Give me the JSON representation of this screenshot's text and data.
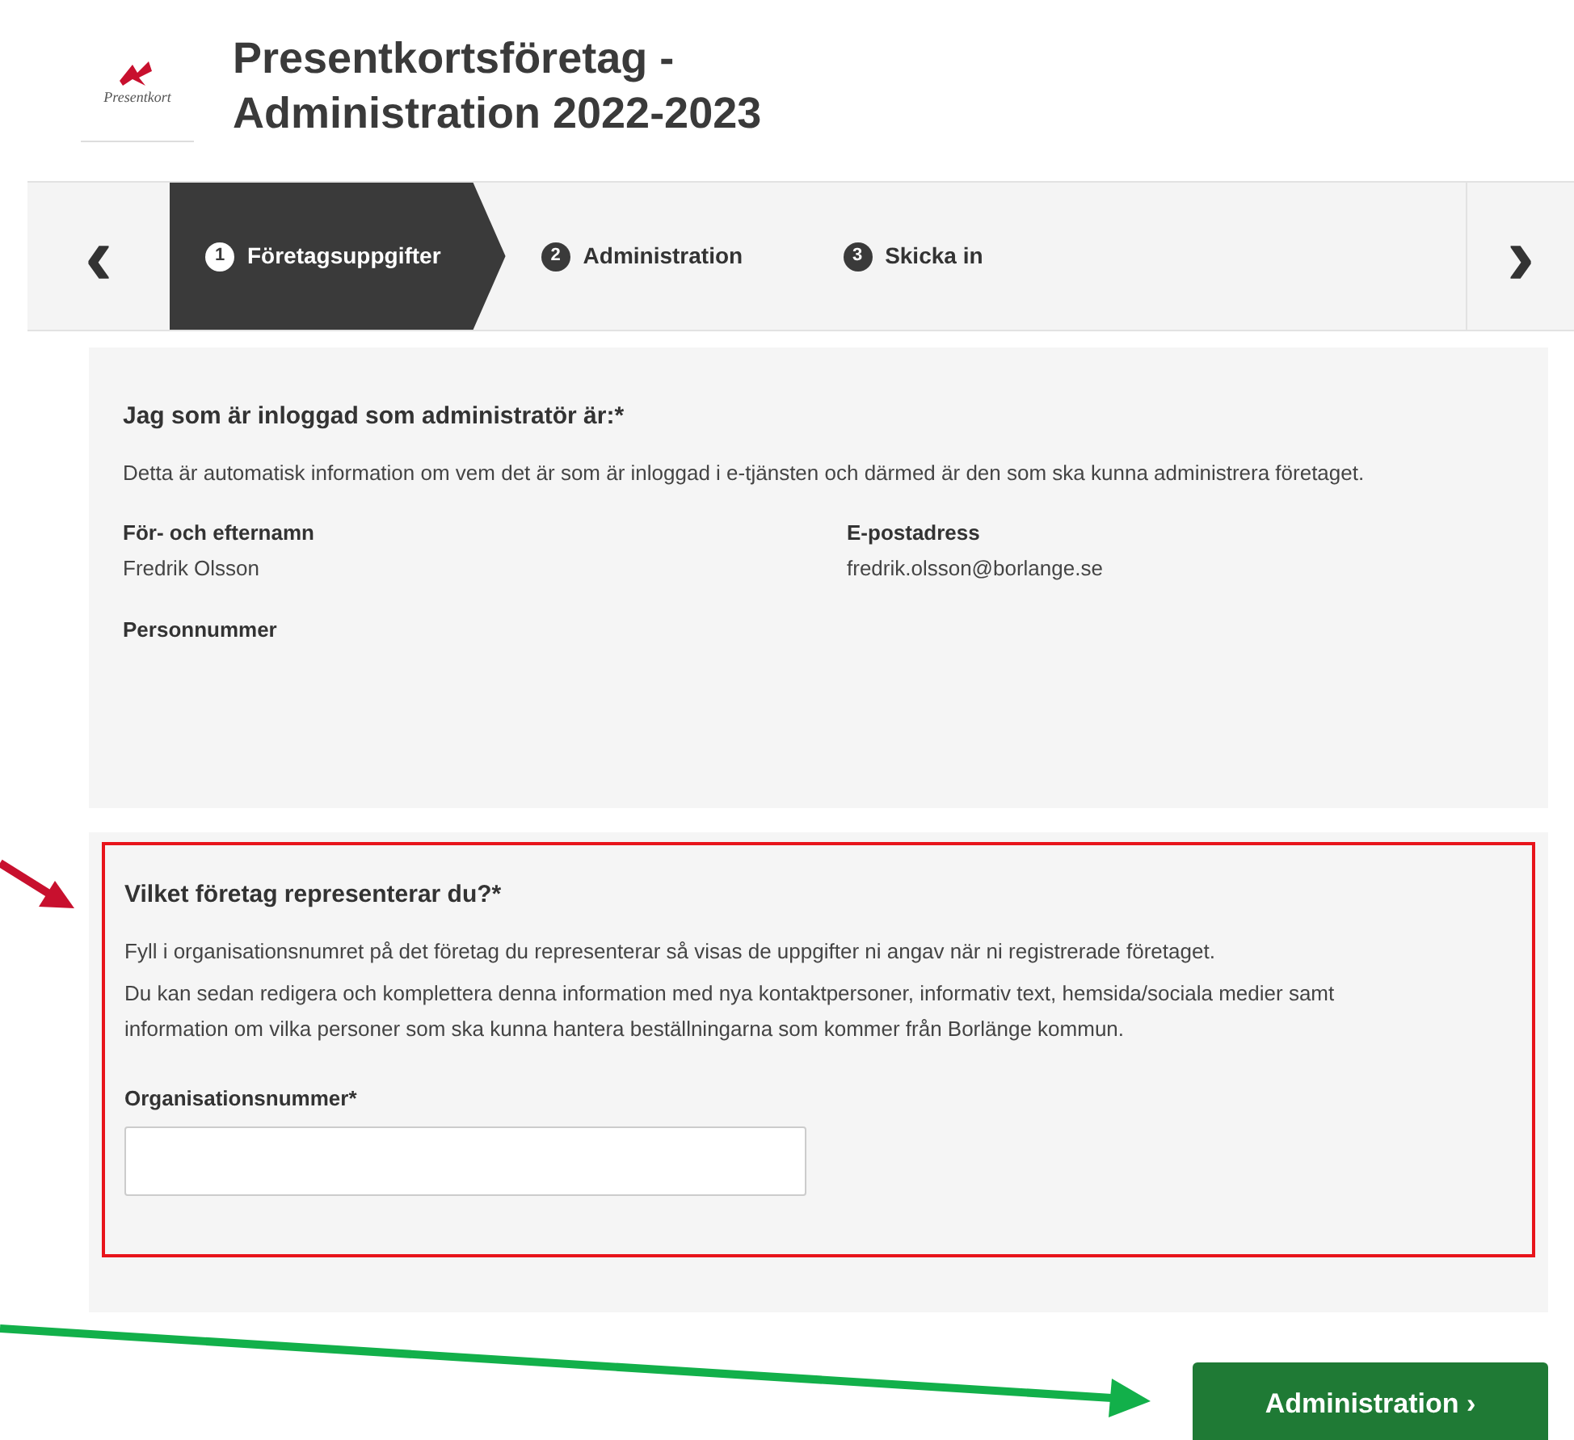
{
  "header": {
    "logo_text": "Presentkort",
    "title_line_1": "Presentkortsföretag -",
    "title_line_2": "Administration 2022-2023"
  },
  "stepper": {
    "prev_icon": "‹",
    "next_icon": "›",
    "steps": [
      {
        "number": "1",
        "label": "Företagsuppgifter",
        "selected": true
      },
      {
        "number": "2",
        "label": "Administration",
        "selected": false
      },
      {
        "number": "3",
        "label": "Skicka in",
        "selected": false
      }
    ]
  },
  "admin_section": {
    "heading": "Jag som är inloggad som administratör är:*",
    "description": "Detta är automatisk information om vem det är som är inloggad i e-tjänsten och därmed är den som ska kunna administrera företaget.",
    "fields": [
      {
        "label": "För- och efternamn",
        "value": "Fredrik Olsson"
      },
      {
        "label": "E-postadress",
        "value": "fredrik.olsson@borlange.se"
      },
      {
        "label": "Personnummer"
      }
    ]
  },
  "company_section": {
    "highlighted": true,
    "heading": "Vilket företag representerar du?*",
    "paragraphs": [
      "Fyll i organisationsnumret på det företag du representerar så visas de uppgifter ni angav när ni registrerade företaget.",
      "Du kan sedan redigera och komplettera denna information med nya kontaktpersoner, informativ text,  hemsida/sociala medier samt information om vilka personer som ska kunna hantera beställningarna som kommer från Borlänge kommun."
    ],
    "field_label": "Organisationsnummer*"
  },
  "next_button": {
    "label": "Administration ›"
  }
}
